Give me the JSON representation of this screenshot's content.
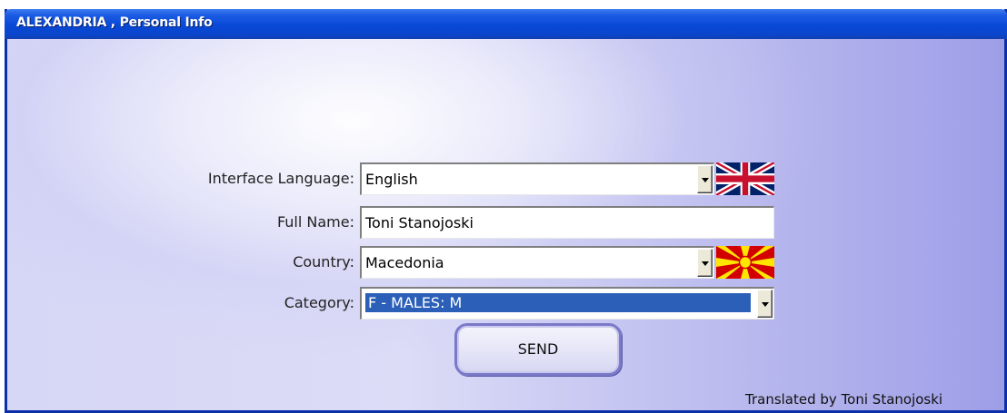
{
  "window": {
    "title": "ALEXANDRIA , Personal Info"
  },
  "form": {
    "interface_language": {
      "label": "Interface Language:",
      "value": "English",
      "flag": "uk-flag-icon"
    },
    "full_name": {
      "label": "Full Name:",
      "value": "Toni Stanojoski"
    },
    "country": {
      "label": "Country:",
      "value": "Macedonia",
      "flag": "macedonia-flag-icon"
    },
    "category": {
      "label": "Category:",
      "value": "F - MALES: M"
    },
    "send_label": "SEND"
  },
  "footer": {
    "credit": "Translated by Toni Stanojoski"
  },
  "colors": {
    "titlebar": "#0848d6",
    "selection": "#2b5fb8",
    "button_border": "#7a7ac8"
  }
}
